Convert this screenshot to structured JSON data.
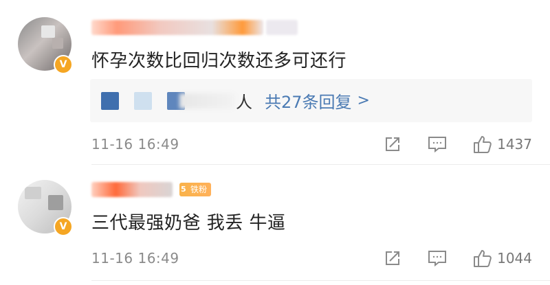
{
  "comments": [
    {
      "text": "怀孕次数比回归次数还多可还行",
      "replies": {
        "person_suffix": "人",
        "count_text": "共27条回复",
        "chevron": ">"
      },
      "time": "11-16 16:49",
      "likes": "1437",
      "verified_badge": "V"
    },
    {
      "text": "三代最强奶爸 我丢 牛逼",
      "fan_badge": {
        "level": "5",
        "label": "铁粉"
      },
      "time": "11-16 16:49",
      "likes": "1044",
      "verified_badge": "V"
    }
  ],
  "icons": [
    "share-icon",
    "comment-icon",
    "like-icon"
  ],
  "colors": {
    "link": "#4a7ab3",
    "badge": "#f5a623",
    "meta": "#8a8a8a"
  }
}
